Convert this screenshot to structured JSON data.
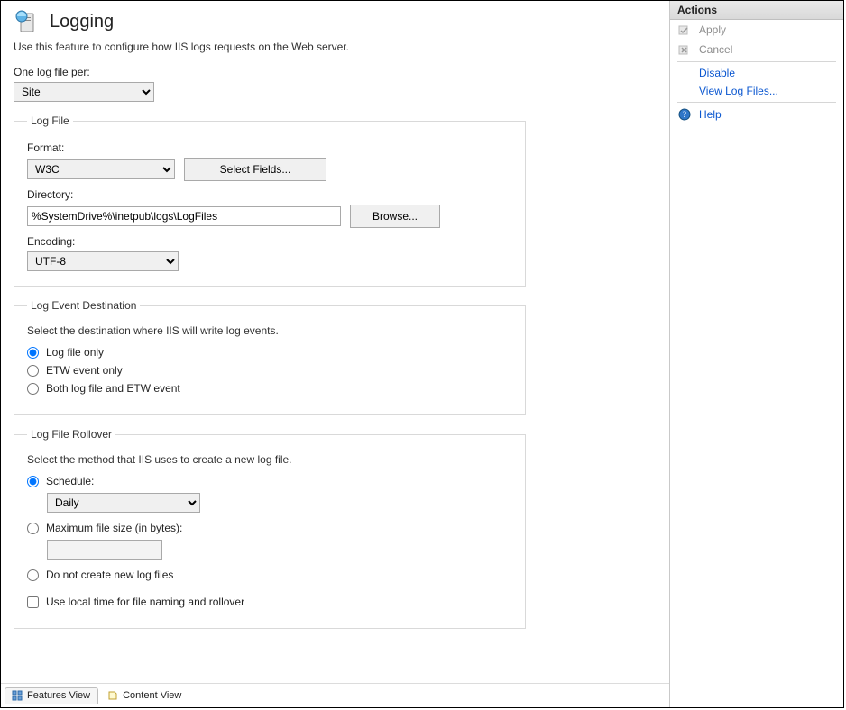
{
  "page": {
    "title": "Logging",
    "description": "Use this feature to configure how IIS logs requests on the Web server."
  },
  "one_log_file_per": {
    "label": "One log file per:",
    "value": "Site"
  },
  "log_file": {
    "legend": "Log File",
    "format_label": "Format:",
    "format_value": "W3C",
    "select_fields_btn": "Select Fields...",
    "directory_label": "Directory:",
    "directory_value": "%SystemDrive%\\inetpub\\logs\\LogFiles",
    "browse_btn": "Browse...",
    "encoding_label": "Encoding:",
    "encoding_value": "UTF-8"
  },
  "log_event_dest": {
    "legend": "Log Event Destination",
    "description": "Select the destination where IIS will write log events.",
    "options": {
      "log_file_only": "Log file only",
      "etw_only": "ETW event only",
      "both": "Both log file and ETW event"
    },
    "selected": "log_file_only"
  },
  "rollover": {
    "legend": "Log File Rollover",
    "description": "Select the method that IIS uses to create a new log file.",
    "schedule_label": "Schedule:",
    "schedule_value": "Daily",
    "max_size_label": "Maximum file size (in bytes):",
    "max_size_value": "",
    "no_new_label": "Do not create new log files",
    "use_local_time_label": "Use local time for file naming and rollover",
    "selected": "schedule",
    "use_local_time_checked": false
  },
  "tabs": {
    "features_view": "Features View",
    "content_view": "Content View"
  },
  "actions": {
    "header": "Actions",
    "apply": "Apply",
    "cancel": "Cancel",
    "disable": "Disable",
    "view_log_files": "View Log Files...",
    "help": "Help"
  }
}
